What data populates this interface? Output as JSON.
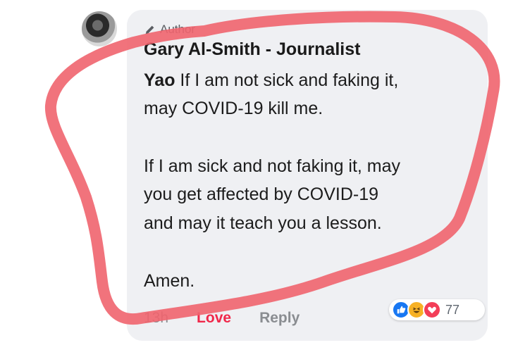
{
  "comment": {
    "badge": "Author",
    "author": "Gary Al-Smith - Journalist",
    "mention": "Yao",
    "lines": [
      " If I am not sick and faking it,",
      "may COVID-19 kill me.",
      "If I am sick and not faking it, may",
      "you get affected by COVID-19",
      "and may it teach you a lesson.",
      "Amen."
    ]
  },
  "actions": {
    "time": "13h",
    "love": "Love",
    "reply": "Reply"
  },
  "reactions": {
    "icons": [
      "like-icon",
      "haha-icon",
      "love-icon"
    ],
    "count": "77"
  },
  "colors": {
    "bubble": "#eff0f3",
    "love": "#f0284a",
    "annotation_marker": "#f0646e"
  }
}
